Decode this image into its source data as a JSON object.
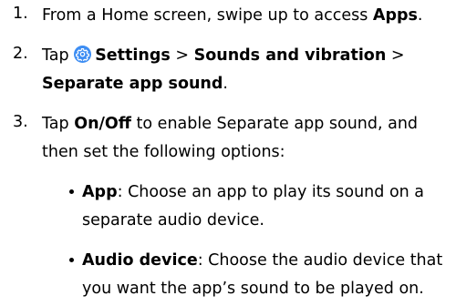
{
  "steps": [
    {
      "number": "1.",
      "pre": "From a Home screen, swipe up to access ",
      "bold": "Apps",
      "post": "."
    },
    {
      "number": "2.",
      "pre": "Tap ",
      "icon": "settings-gear-icon",
      "settings": "Settings",
      "sep1": " > ",
      "sounds": "Sounds and vibration",
      "sep2": " >",
      "separate": "Separate app sound",
      "end": "."
    },
    {
      "number": "3.",
      "pre": "Tap ",
      "onoff": "On/Off",
      "line1_post": " to enable Separate app sound, and",
      "line2": "then set the following options:"
    }
  ],
  "options": [
    {
      "bold": "App",
      "line1_rest": ": Choose an app to play its sound on a",
      "line2": "separate audio device."
    },
    {
      "bold": "Audio device",
      "line1_rest": ": Choose the audio device that",
      "line2": "you want the app’s sound to be played on."
    }
  ],
  "colors": {
    "icon_background": "#3c8df3"
  }
}
